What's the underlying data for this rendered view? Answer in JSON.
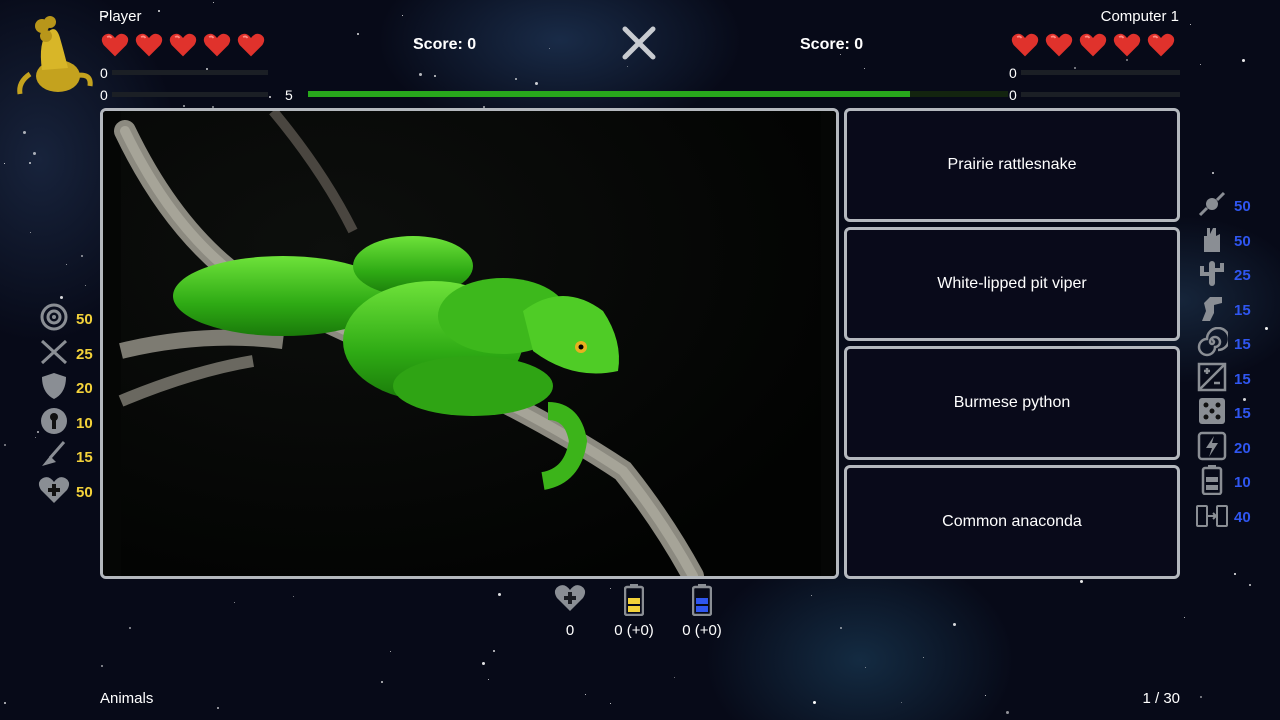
{
  "player": {
    "name": "Player",
    "score": "Score: 0",
    "hearts": 5,
    "stat1": "0",
    "stat2": "0",
    "timer": "5"
  },
  "computer": {
    "name": "Computer 1",
    "score": "Score: 0",
    "hearts": 5,
    "stat1": "0",
    "stat2": "0"
  },
  "timer_progress": 0.86,
  "question_image": "green pit viper coiled on a branch",
  "answers": [
    "Prairie rattlesnake",
    "White-lipped pit viper",
    "Burmese python",
    "Common anaconda"
  ],
  "left_powerups": [
    {
      "icon": "target-icon",
      "value": "50"
    },
    {
      "icon": "crossed-arrows-icon",
      "value": "25"
    },
    {
      "icon": "shield-icon",
      "value": "20"
    },
    {
      "icon": "keyhole-icon",
      "value": "10"
    },
    {
      "icon": "broom-icon",
      "value": "15"
    },
    {
      "icon": "heart-plus-icon",
      "value": "50"
    }
  ],
  "right_powerups": [
    {
      "icon": "candy-icon",
      "value": "50"
    },
    {
      "icon": "hand-icon",
      "value": "50"
    },
    {
      "icon": "cactus-icon",
      "value": "25"
    },
    {
      "icon": "dinosaur-icon",
      "value": "15"
    },
    {
      "icon": "spiral-icon",
      "value": "15"
    },
    {
      "icon": "plus-minus-icon",
      "value": "15"
    },
    {
      "icon": "dice-icon",
      "value": "15"
    },
    {
      "icon": "lightning-icon",
      "value": "20"
    },
    {
      "icon": "battery-icon",
      "value": "10"
    },
    {
      "icon": "battery-transfer-icon",
      "value": "40"
    }
  ],
  "bottom": {
    "hearts": "0",
    "yellow_battery": "0 (+0)",
    "blue_battery": "0 (+0)"
  },
  "footer": {
    "category": "Animals",
    "progress": "1 / 30"
  },
  "colors": {
    "heart": "#e0322c",
    "timer_green": "#28a81c",
    "accent_yellow": "#f3d23a",
    "accent_blue": "#2f56f0",
    "panel_border": "#b4b8be"
  }
}
